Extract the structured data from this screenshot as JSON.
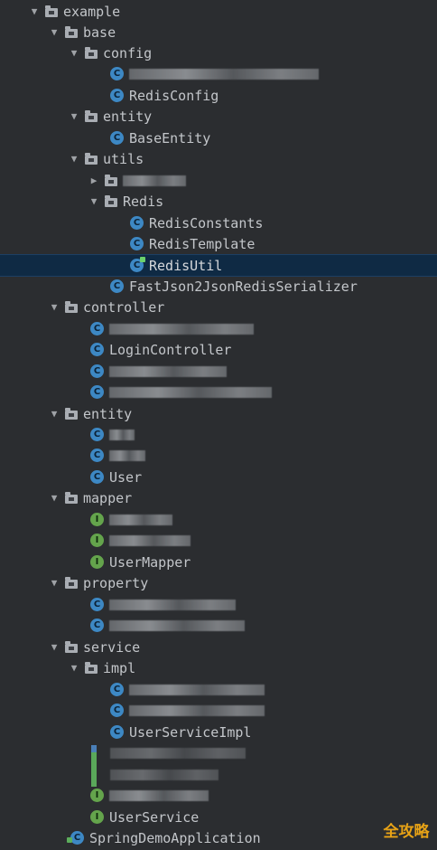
{
  "tree": {
    "example": "example",
    "base": "base",
    "config": "config",
    "redis_config": "RedisConfig",
    "entity": "entity",
    "base_entity": "BaseEntity",
    "utils": "utils",
    "redis": "Redis",
    "redis_constants": "RedisConstants",
    "redis_template": "RedisTemplate",
    "redis_util": "RedisUtil",
    "fastjson_serializer": "FastJson2JsonRedisSerializer",
    "controller": "controller",
    "login_controller": "LoginController",
    "entity2": "entity",
    "user": "User",
    "mapper": "mapper",
    "user_mapper": "UserMapper",
    "property": "property",
    "service": "service",
    "impl": "impl",
    "user_service_impl": "UserServiceImpl",
    "user_service": "UserService",
    "spring_app": "SpringDemoApplication"
  },
  "icons": {
    "class_letter": "C",
    "interface_letter": "I"
  },
  "watermark": "全攻略",
  "colors": {
    "selection": "#0f2a44",
    "class_icon": "#3d88c4",
    "interface_icon": "#64a44c",
    "watermark": "#e8a316"
  }
}
